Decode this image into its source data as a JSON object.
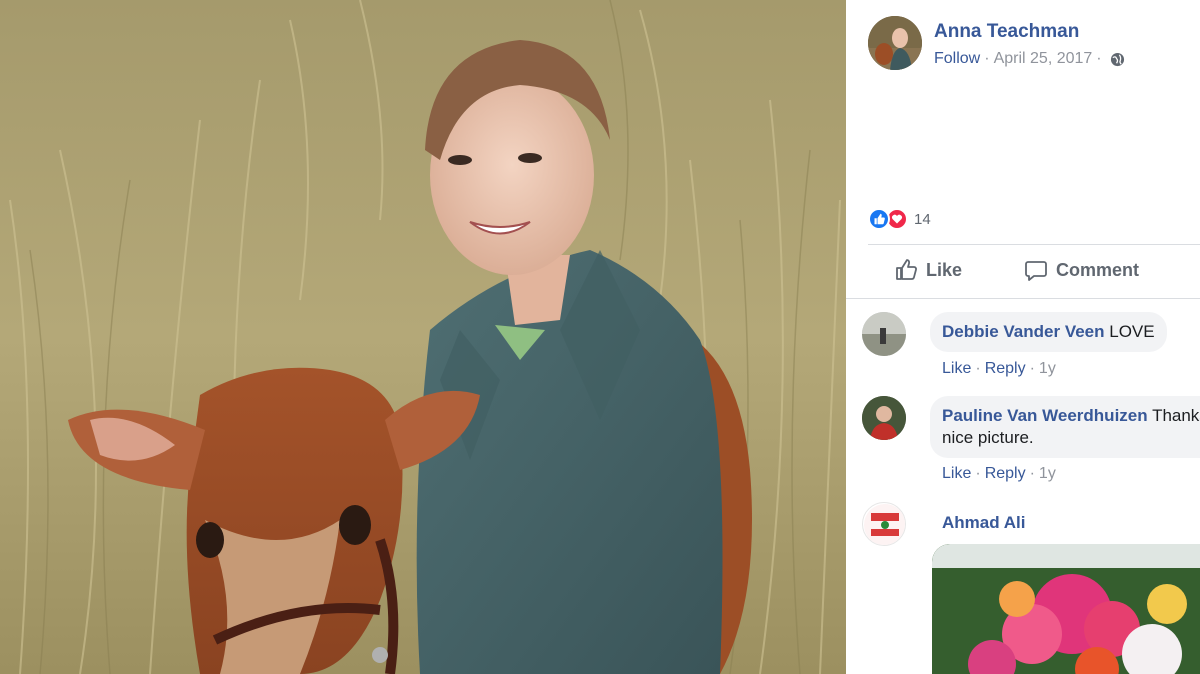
{
  "post": {
    "author": "Anna Teachman",
    "follow_label": "Follow",
    "separator": "·",
    "date": "April 25, 2017",
    "privacy_icon": "globe-icon",
    "reaction_icons": [
      "like-reaction-icon",
      "love-reaction-icon"
    ],
    "reaction_count": "14"
  },
  "actions": {
    "like_label": "Like",
    "comment_label": "Comment"
  },
  "comments": [
    {
      "name": "Debbie Vander Veen",
      "text": "LOVE",
      "like": "Like",
      "reply": "Reply",
      "time": "1y"
    },
    {
      "name": "Pauline Van Weerdhuizen",
      "text": "Thanks",
      "text2": "nice picture.",
      "like": "Like",
      "reply": "Reply",
      "time": "1y"
    },
    {
      "name": "Ahmad Ali"
    }
  ],
  "colors": {
    "link": "#385898",
    "like_blue": "#1877f2",
    "love_red": "#f0284a",
    "bubble_bg": "#f2f3f5"
  }
}
